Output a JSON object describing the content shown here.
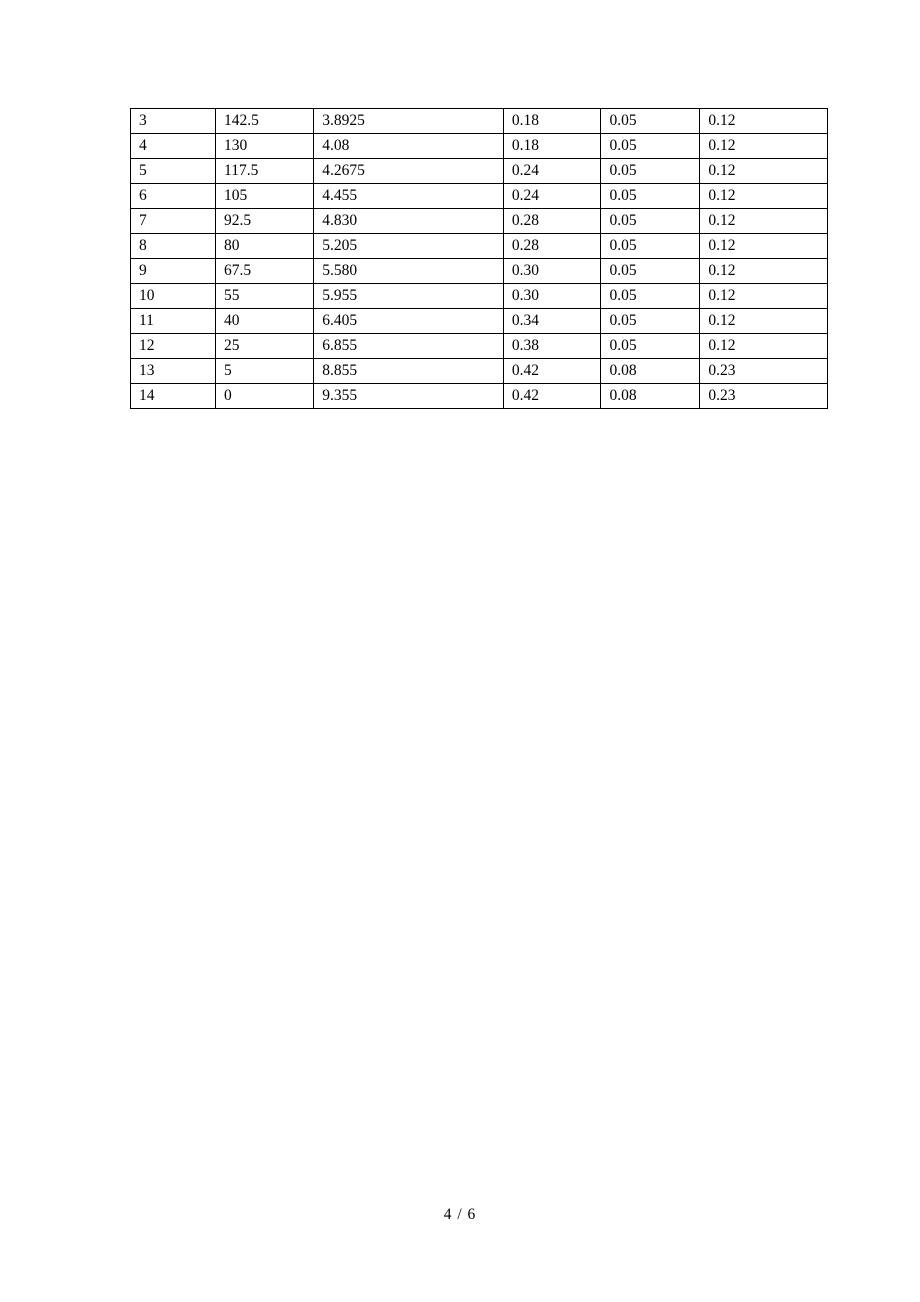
{
  "table": {
    "rows": [
      [
        "3",
        "142.5",
        "3.8925",
        "0.18",
        "0.05",
        "0.12"
      ],
      [
        "4",
        "130",
        "4.08",
        "0.18",
        "0.05",
        "0.12"
      ],
      [
        "5",
        "117.5",
        "4.2675",
        "0.24",
        "0.05",
        "0.12"
      ],
      [
        "6",
        "105",
        "4.455",
        "0.24",
        "0.05",
        "0.12"
      ],
      [
        "7",
        "92.5",
        "4.830",
        "0.28",
        "0.05",
        "0.12"
      ],
      [
        "8",
        "80",
        "5.205",
        "0.28",
        "0.05",
        "0.12"
      ],
      [
        "9",
        "67.5",
        "5.580",
        "0.30",
        "0.05",
        "0.12"
      ],
      [
        "10",
        "55",
        "5.955",
        "0.30",
        "0.05",
        "0.12"
      ],
      [
        "11",
        "40",
        "6.405",
        "0.34",
        "0.05",
        "0.12"
      ],
      [
        "12",
        "25",
        "6.855",
        "0.38",
        "0.05",
        "0.12"
      ],
      [
        "13",
        "5",
        "8.855",
        "0.42",
        "0.08",
        "0.23"
      ],
      [
        "14",
        "0",
        "9.355",
        "0.42",
        "0.08",
        "0.23"
      ]
    ]
  },
  "footer": {
    "page_label": "4 / 6"
  }
}
